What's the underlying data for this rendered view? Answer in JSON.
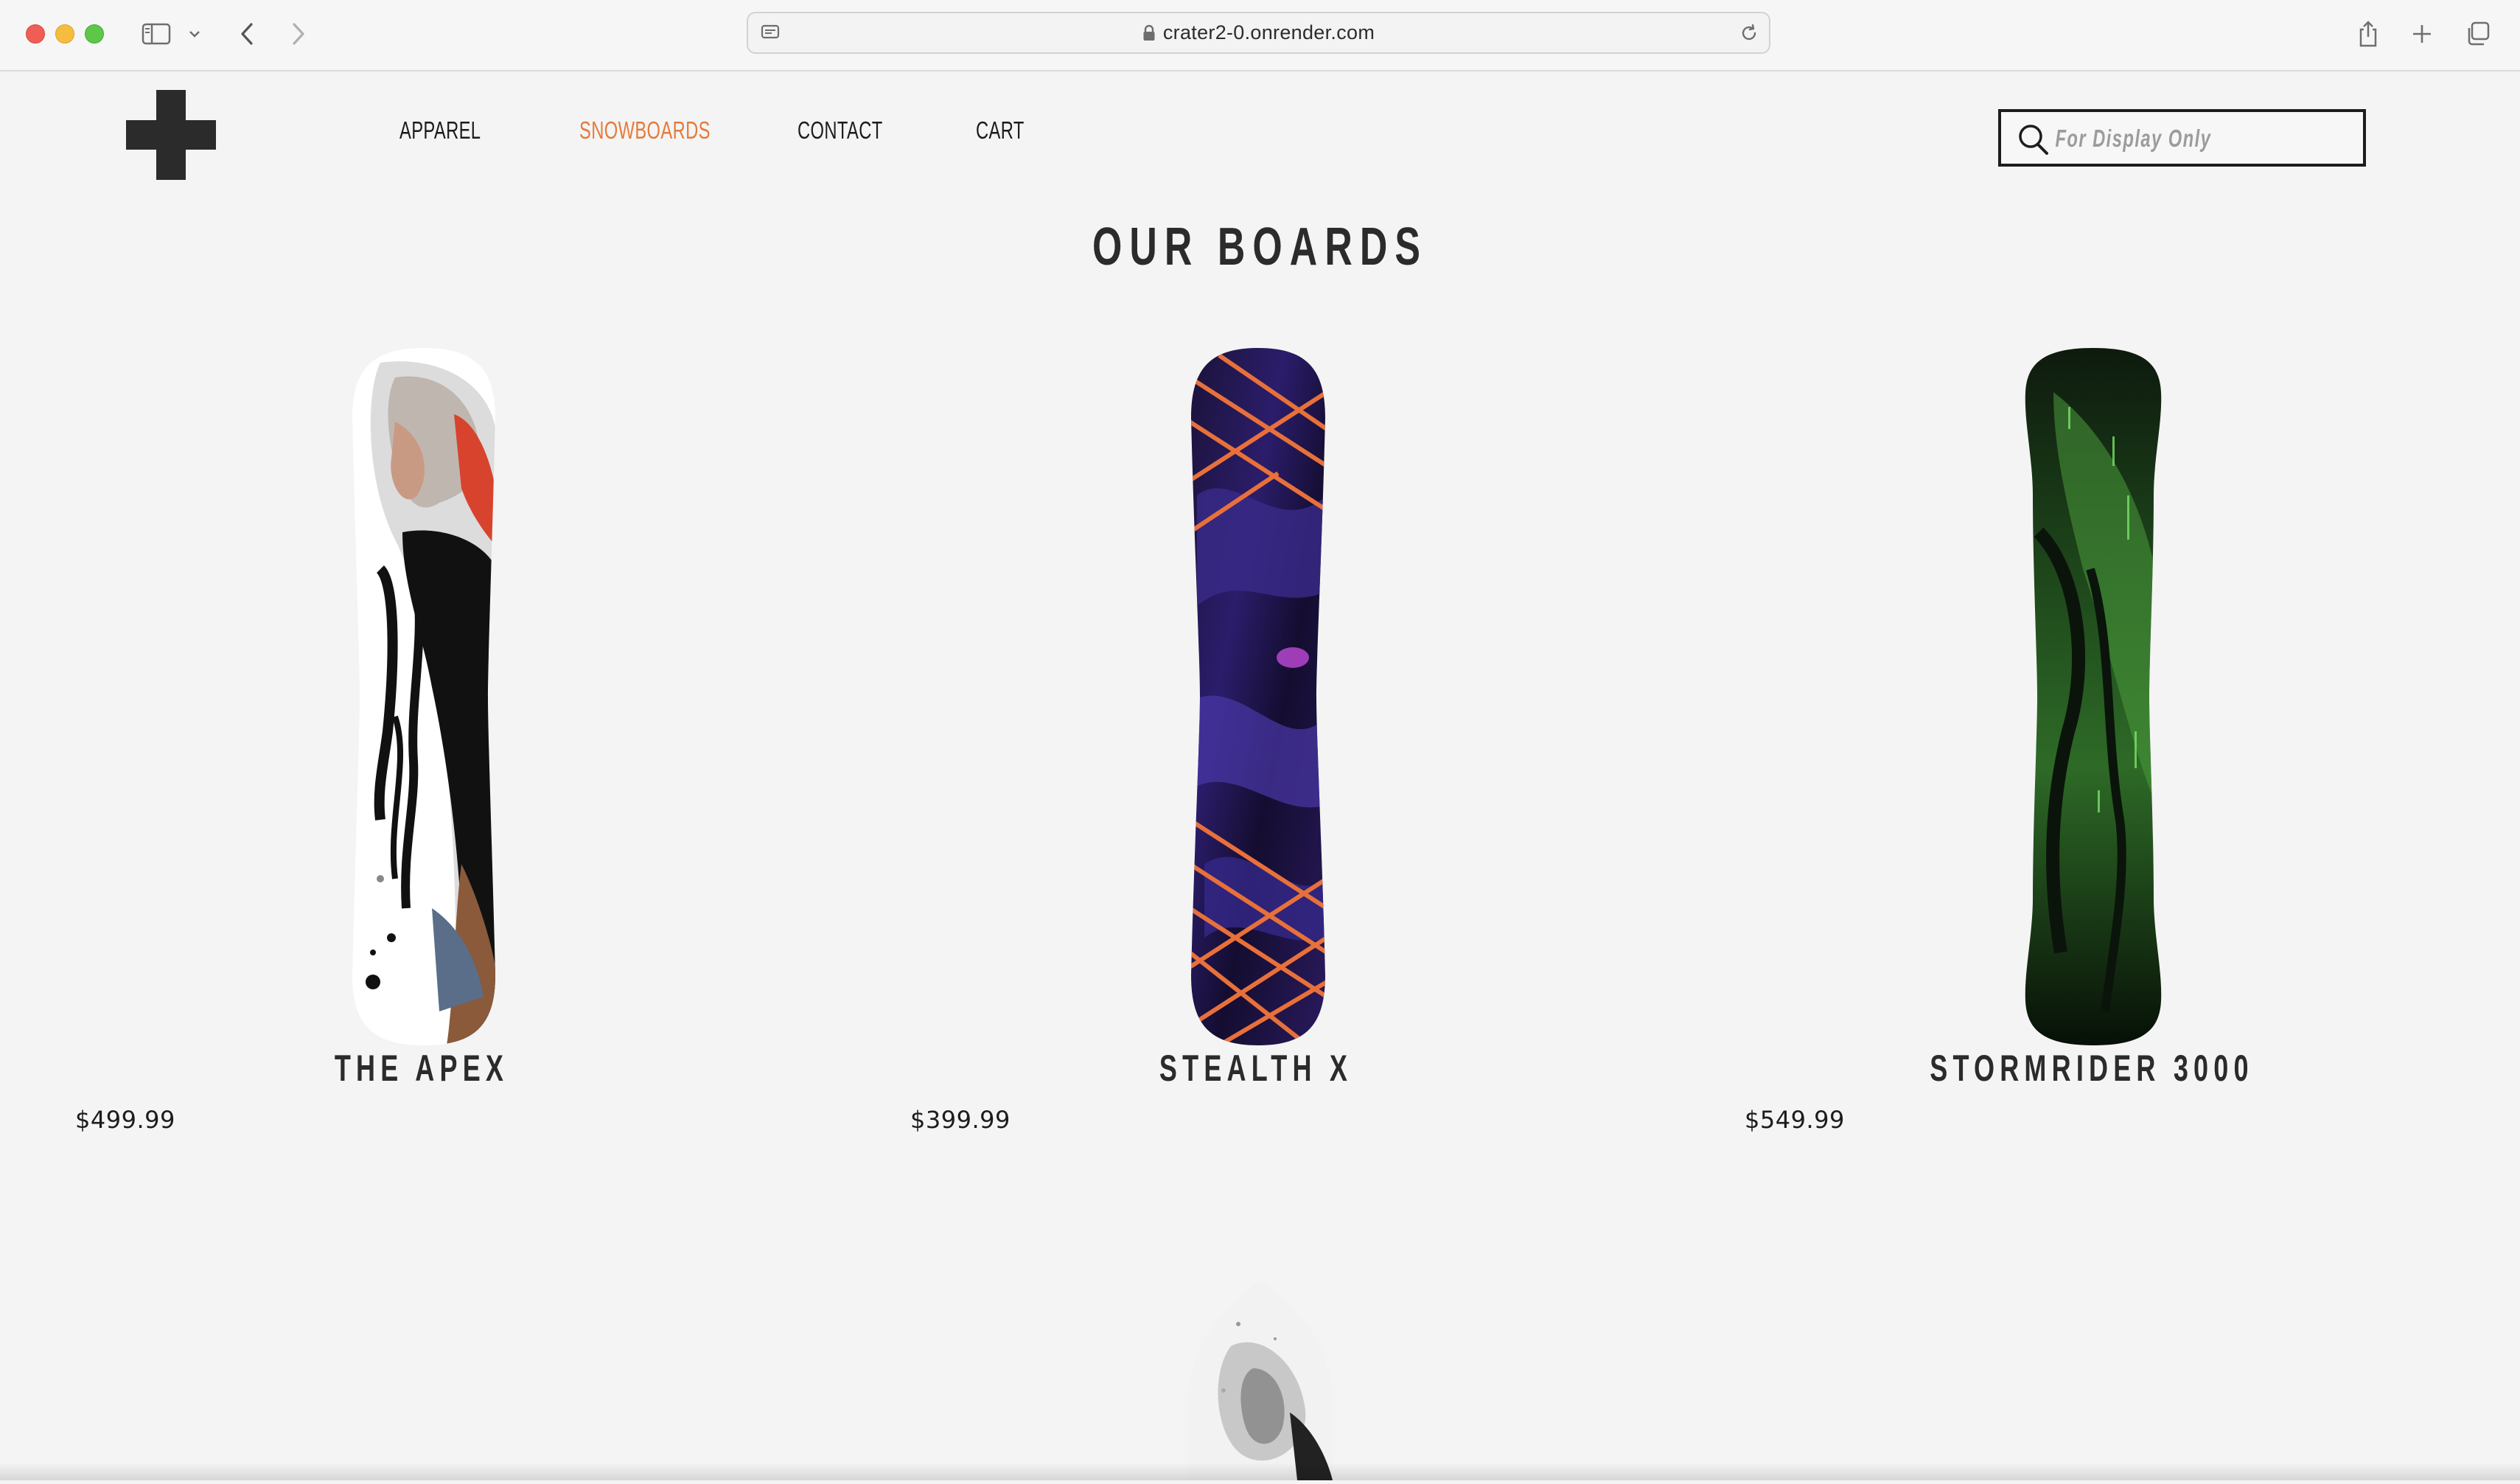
{
  "browser": {
    "url": "crater2-0.onrender.com"
  },
  "site": {
    "nav": [
      {
        "label": "APPAREL"
      },
      {
        "label": "SNOWBOARDS",
        "active": true
      },
      {
        "label": "CONTACT"
      },
      {
        "label": "CART"
      }
    ],
    "search": {
      "placeholder": "For Display Only"
    },
    "page_title": "OUR BOARDS",
    "accent_color": "#e57a3a"
  },
  "products": [
    {
      "name": "THE APEX",
      "price": "$499.99"
    },
    {
      "name": "STEALTH X",
      "price": "$399.99"
    },
    {
      "name": "STORMRIDER 3000",
      "price": "$549.99"
    }
  ]
}
